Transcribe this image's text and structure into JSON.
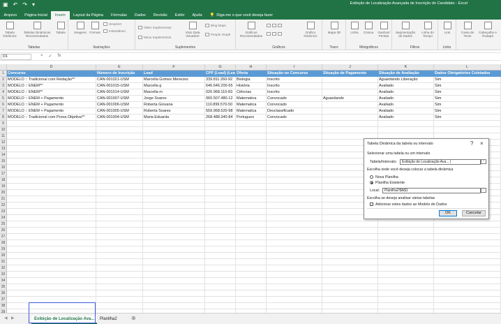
{
  "window": {
    "title": "Exibição de Localização Avançada de Inscrição do Candidato  -  Excel",
    "accent": "#217346"
  },
  "qat": {
    "save_icon": "save-icon",
    "undo_icon": "undo-icon",
    "redo_icon": "redo-icon"
  },
  "tabs": [
    "Arquivo",
    "Página Inicial",
    "Inserir",
    "Layout da Página",
    "Fórmulas",
    "Dados",
    "Revisão",
    "Exibir",
    "Ajuda"
  ],
  "active_tab": "Inserir",
  "tell_me": "Diga-me o que você deseja fazer",
  "ribbon": {
    "groups": {
      "tabelas": "Tabelas",
      "ilustracoes": "Ilustrações",
      "suplementos": "Suplementos",
      "graficos": "Gráficos",
      "tours": "Tours",
      "minigraficos": "Minigráficos",
      "filtros": "Filtros",
      "links": "Links"
    },
    "buttons": {
      "tabela_dinamica": "Tabela Dinâmica",
      "tabelas_recomendadas": "Tabelas Dinâmicas Recomendadas",
      "tabela": "Tabela",
      "imagens": "Imagens",
      "formas": "Formas",
      "smartart": "SmartArt",
      "instantaneo": "Instantâneo",
      "obter_suplementos": "Obter Suplementos",
      "meus_suplementos": "Meus Suplementos",
      "bing_maps": "Bing Maps",
      "people_graph": "People Graph",
      "visio": "Visio Data Visualizer",
      "graficos_recomendados": "Gráficos Recomendados",
      "grafico_dinamico": "Gráfico Dinâmico",
      "mapa3d": "Mapa 3D",
      "linha": "Linha",
      "coluna": "Coluna",
      "ganhos_perdas": "Ganhos/ Perdas",
      "segmentacao": "Segmentação de Dados",
      "linha_tempo": "Linha do Tempo",
      "link": "Link",
      "caixa_texto": "Caixa de Texto",
      "cabecalho": "Cabeçalho e Rodapé"
    }
  },
  "formula_bar": {
    "name_box": "D1",
    "cancel": "×",
    "enter": "✓",
    "fx": "fx",
    "value": ""
  },
  "grid": {
    "columns": [
      "D",
      "E",
      "F",
      "G",
      "H",
      "I",
      "J",
      "K",
      "L"
    ],
    "row_numbers": [
      "1",
      "2",
      "3",
      "4",
      "5",
      "6",
      "7",
      "8",
      "9",
      "10",
      "11",
      "12",
      "13",
      "14",
      "15",
      "16",
      "17",
      "18",
      "19",
      "20",
      "21",
      "22",
      "23",
      "24",
      "25",
      "26",
      "27",
      "28",
      "29",
      "30",
      "31",
      "32",
      "33",
      "34",
      "35",
      "36",
      "37",
      "38",
      "39"
    ],
    "header": [
      "Concurso",
      "Número de Inscrição",
      "Lead",
      "CPF (Lead) (Lea",
      "Oferta",
      "Situação no Concurso",
      "Situação de Pagamento",
      "Situação de Avaliação",
      "Dados Obrigatórios Coletados"
    ],
    "header_color": "#5b9bd5",
    "rows": [
      [
        "MODELO :: Tradicional com Redação**",
        "CAN-001021-USM",
        "Marcella Gomes Menezes",
        "339.811.260-92",
        "Biologia",
        "Inscrito",
        "",
        "Aguardando Liberação",
        "Sim"
      ],
      [
        "MODELO :: ENEM**",
        "CAN-001015-USM",
        "Marcella g",
        "646.646.200-55",
        "História",
        "Inscrito",
        "",
        "Avaliado",
        "Sim"
      ],
      [
        "MODELO :: ENEM**",
        "CAN-001014-USM",
        "Marcella m",
        "026.968.110-83",
        "Ciências",
        "Inscrito",
        "",
        "Avaliado",
        "Sim"
      ],
      [
        "MODELO :: ENEM + Pagamento",
        "CAN-001007-USM",
        "Jorge Soares",
        "060.507.480-12",
        "Matematica",
        "Convocado",
        "Aguardando",
        "Avaliado",
        "Sim"
      ],
      [
        "MODELO :: ENEM + Pagamento",
        "CAN-001006-USM",
        "Roberta Giovana",
        "110.899.570-50",
        "Matematica",
        "Convocado",
        "",
        "Avaliado",
        "Sim"
      ],
      [
        "MODELO :: ENEM + Pagamento",
        "CAN-001005-USM",
        "Roberta Soares",
        "559.968.520-98",
        "Matematica",
        "Desclassificado",
        "",
        "Avaliado",
        "Sim"
      ],
      [
        "MODELO :: Tradicional com Prova Objetiva**",
        "CAN-001004-USM",
        "Maria Eduarda",
        "268.488.340-84",
        "Portugues",
        "Convocado",
        "",
        "Avaliado",
        "Sim"
      ]
    ]
  },
  "sheets": [
    "Exibição de Localização Ava...",
    "Planilha2"
  ],
  "active_sheet": "Exibição de Localização Ava...",
  "dialog": {
    "title": "Tabela Dinâmica da tabela ou intervalo",
    "help": "?",
    "close": "×",
    "select_label": "Selecionar uma tabela ou um intervalo",
    "range_label": "Tabela/Intervalo:",
    "range_value": "Exibição de Localização Ava... |",
    "place_label": "Escolha onde você deseja colocar a tabela dinâmica",
    "opt_new": "Nova Planilha",
    "opt_existing": "Planilha Existente",
    "selected_option": "existing",
    "local_label": "Local:",
    "local_value": "Planilha2!$A$1",
    "multi_label": "Escolha se deseja analisar várias tabelas",
    "model_label": "Adicionar estes dados ao Modelo de Dados",
    "model_checked": false,
    "ok": "OK",
    "cancel": "Cancelar",
    "collapse_icon": "↑"
  }
}
